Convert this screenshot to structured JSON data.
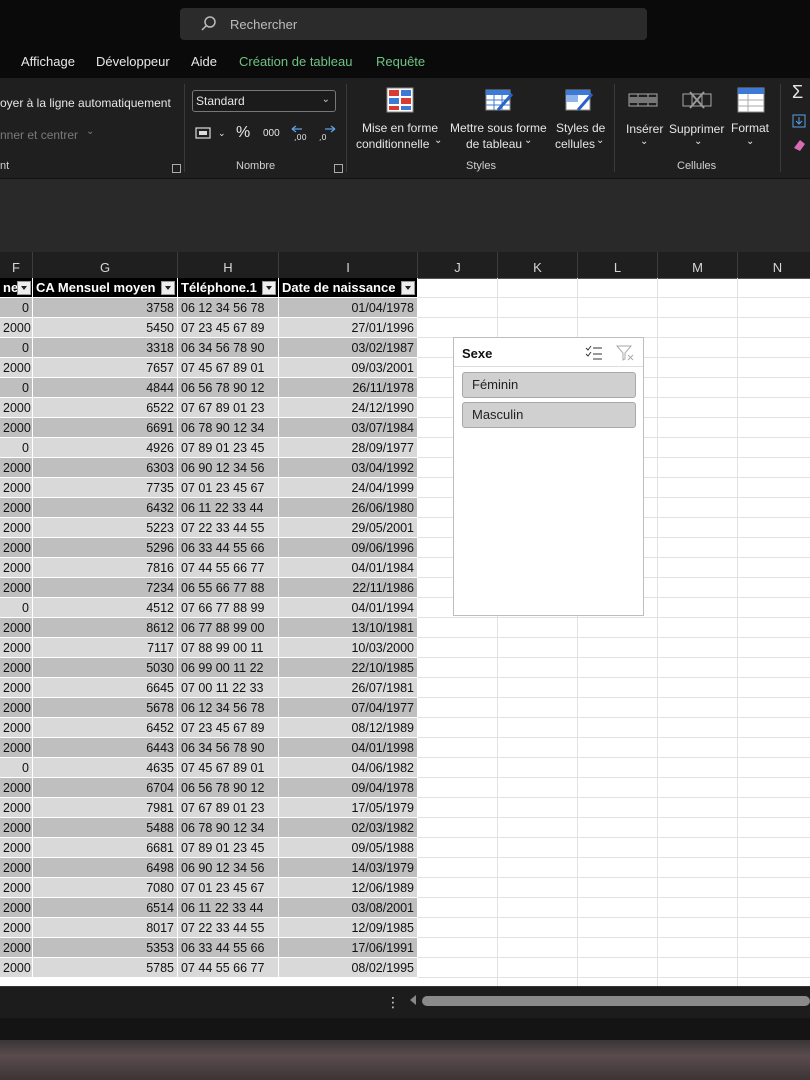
{
  "search": {
    "placeholder": "Rechercher",
    "icon": "search-icon"
  },
  "menu": {
    "items": [
      "Affichage",
      "Développeur",
      "Aide"
    ],
    "contextual": [
      "Création de tableau",
      "Requête"
    ],
    "contextual_color": "#6ec383"
  },
  "ribbon": {
    "alignment": {
      "wrap_text": "oyer à la ligne automatiquement",
      "merge_center": "nner et centrer",
      "group_label": "nt"
    },
    "number": {
      "format": "Standard",
      "group_label": "Nombre",
      "percent": "%",
      "thousands": "000"
    },
    "styles": {
      "conditional_l1": "Mise en forme",
      "conditional_l2": "conditionnelle",
      "as_table_l1": "Mettre sous forme",
      "as_table_l2": "de tableau",
      "cell_styles_l1": "Styles de",
      "cell_styles_l2": "cellules",
      "group_label": "Styles"
    },
    "cells": {
      "insert": "Insérer",
      "delete": "Supprimer",
      "format": "Format",
      "group_label": "Cellules"
    }
  },
  "columns": [
    "F",
    "G",
    "H",
    "I",
    "J",
    "K",
    "L",
    "M",
    "N"
  ],
  "table": {
    "headers": [
      "ne",
      "CA Mensuel moyen",
      "Téléphone.1",
      "Date de naissance"
    ],
    "rows": [
      [
        "0",
        "3758",
        "06 12 34 56 78",
        "01/04/1978"
      ],
      [
        "2000",
        "5450",
        "07 23 45 67 89",
        "27/01/1996"
      ],
      [
        "0",
        "3318",
        "06 34 56 78 90",
        "03/02/1987"
      ],
      [
        "2000",
        "7657",
        "07 45 67 89 01",
        "09/03/2001"
      ],
      [
        "0",
        "4844",
        "06 56 78 90 12",
        "26/11/1978"
      ],
      [
        "2000",
        "6522",
        "07 67 89 01 23",
        "24/12/1990"
      ],
      [
        "2000",
        "6691",
        "06 78 90 12 34",
        "03/07/1984"
      ],
      [
        "0",
        "4926",
        "07 89 01 23 45",
        "28/09/1977"
      ],
      [
        "2000",
        "6303",
        "06 90 12 34 56",
        "03/04/1992"
      ],
      [
        "2000",
        "7735",
        "07 01 23 45 67",
        "24/04/1999"
      ],
      [
        "2000",
        "6432",
        "06 11 22 33 44",
        "26/06/1980"
      ],
      [
        "2000",
        "5223",
        "07 22 33 44 55",
        "29/05/2001"
      ],
      [
        "2000",
        "5296",
        "06 33 44 55 66",
        "09/06/1996"
      ],
      [
        "2000",
        "7816",
        "07 44 55 66 77",
        "04/01/1984"
      ],
      [
        "2000",
        "7234",
        "06 55 66 77 88",
        "22/11/1986"
      ],
      [
        "0",
        "4512",
        "07 66 77 88 99",
        "04/01/1994"
      ],
      [
        "2000",
        "8612",
        "06 77 88 99 00",
        "13/10/1981"
      ],
      [
        "2000",
        "7117",
        "07 88 99 00 11",
        "10/03/2000"
      ],
      [
        "2000",
        "5030",
        "06 99 00 11 22",
        "22/10/1985"
      ],
      [
        "2000",
        "6645",
        "07 00 11 22 33",
        "26/07/1981"
      ],
      [
        "2000",
        "5678",
        "06 12 34 56 78",
        "07/04/1977"
      ],
      [
        "2000",
        "6452",
        "07 23 45 67 89",
        "08/12/1989"
      ],
      [
        "2000",
        "6443",
        "06 34 56 78 90",
        "04/01/1998"
      ],
      [
        "0",
        "4635",
        "07 45 67 89 01",
        "04/06/1982"
      ],
      [
        "2000",
        "6704",
        "06 56 78 90 12",
        "09/04/1978"
      ],
      [
        "2000",
        "7981",
        "07 67 89 01 23",
        "17/05/1979"
      ],
      [
        "2000",
        "5488",
        "06 78 90 12 34",
        "02/03/1982"
      ],
      [
        "2000",
        "6681",
        "07 89 01 23 45",
        "09/05/1988"
      ],
      [
        "2000",
        "6498",
        "06 90 12 34 56",
        "14/03/1979"
      ],
      [
        "2000",
        "7080",
        "07 01 23 45 67",
        "12/06/1989"
      ],
      [
        "2000",
        "6514",
        "06 11 22 33 44",
        "03/08/2001"
      ],
      [
        "2000",
        "8017",
        "07 22 33 44 55",
        "12/09/1985"
      ],
      [
        "2000",
        "5353",
        "06 33 44 55 66",
        "17/06/1991"
      ],
      [
        "2000",
        "5785",
        "07 44 55 66 77",
        "08/02/1995"
      ]
    ],
    "band_colors": [
      "#bfbfbf",
      "#d9d9d9"
    ]
  },
  "slicer": {
    "title": "Sexe",
    "items": [
      "Féminin",
      "Masculin"
    ]
  },
  "sheetbar": {
    "more": "⋮"
  }
}
